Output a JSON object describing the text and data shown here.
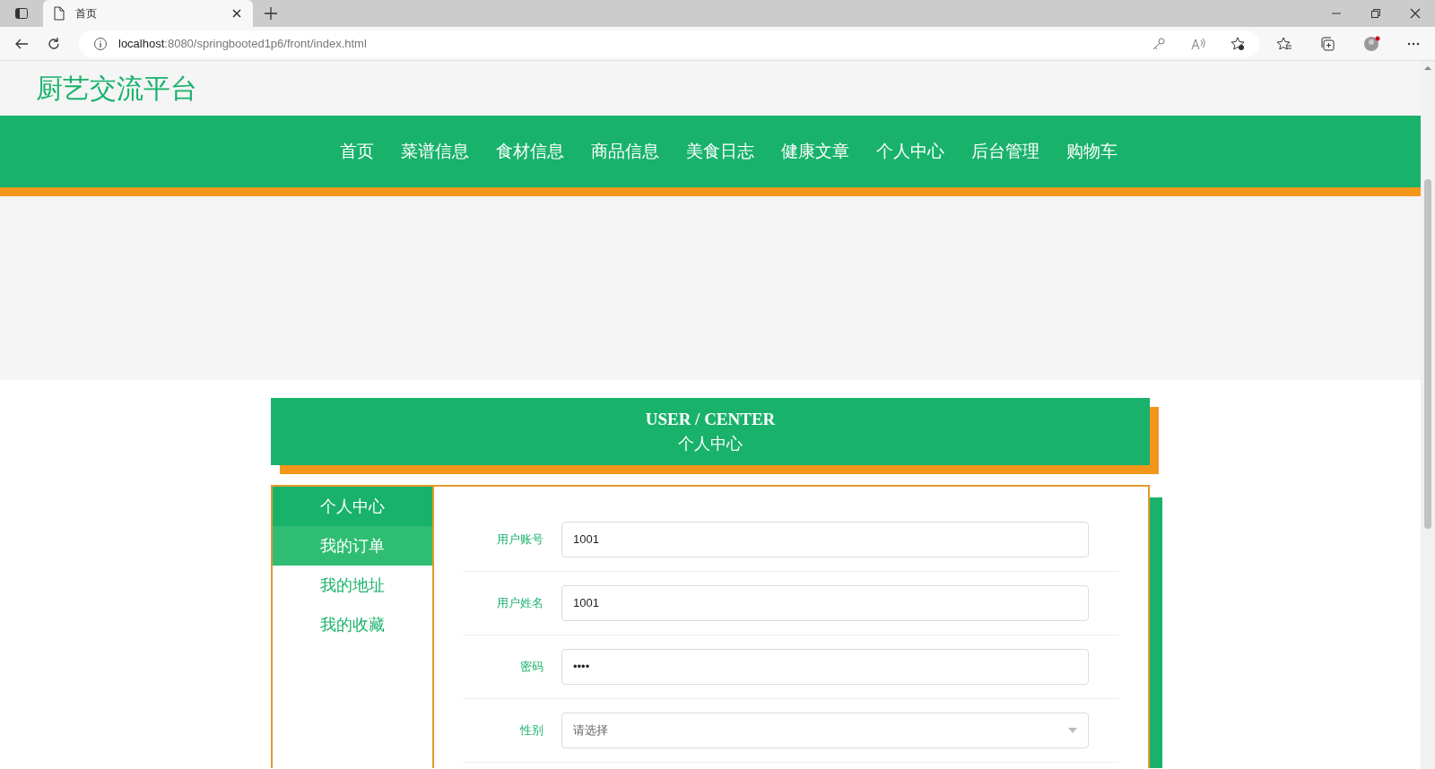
{
  "browser": {
    "tab_title": "首页",
    "url_host": "localhost",
    "url_rest": ":8080/springbooted1p6/front/index.html"
  },
  "site_title": "厨艺交流平台",
  "nav": [
    {
      "label": "首页"
    },
    {
      "label": "菜谱信息"
    },
    {
      "label": "食材信息"
    },
    {
      "label": "商品信息"
    },
    {
      "label": "美食日志"
    },
    {
      "label": "健康文章"
    },
    {
      "label": "个人中心"
    },
    {
      "label": "后台管理"
    },
    {
      "label": "购物车"
    }
  ],
  "banner": {
    "title_en": "USER / CENTER",
    "title_cn": "个人中心"
  },
  "sidebar": [
    {
      "label": "个人中心",
      "selected": true,
      "hovered": false
    },
    {
      "label": "我的订单",
      "selected": false,
      "hovered": true
    },
    {
      "label": "我的地址",
      "selected": false,
      "hovered": false
    },
    {
      "label": "我的收藏",
      "selected": false,
      "hovered": false
    }
  ],
  "form": [
    {
      "kind": "text",
      "label": "用户账号",
      "value": "1001"
    },
    {
      "kind": "text",
      "label": "用户姓名",
      "value": "1001"
    },
    {
      "kind": "password",
      "label": "密码",
      "value": "••••"
    },
    {
      "kind": "select",
      "label": "性别",
      "placeholder": "请选择"
    }
  ]
}
